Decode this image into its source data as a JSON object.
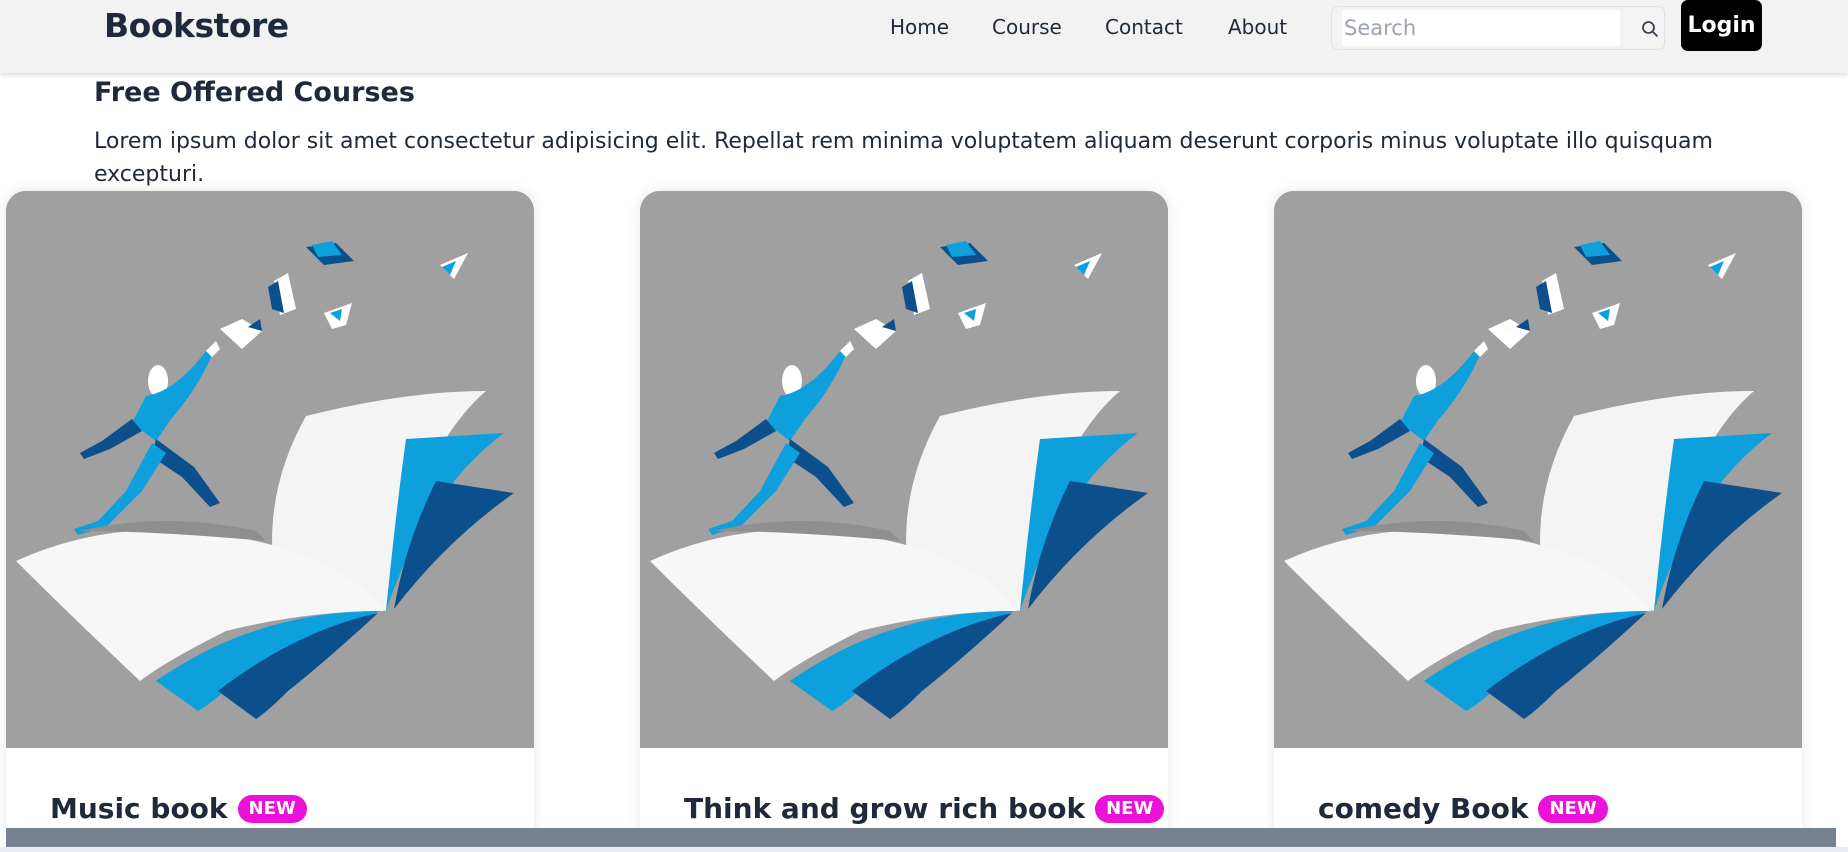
{
  "brand": "Bookstore",
  "nav": {
    "home": "Home",
    "course": "Course",
    "contact": "Contact",
    "about": "About"
  },
  "search": {
    "placeholder": "Search",
    "value": ""
  },
  "login_label": "Login",
  "section": {
    "title": "Free Offered Courses",
    "description": "Lorem ipsum dolor sit amet consectetur adipisicing elit. Repellat rem minima voluptatem aliquam deserunt corporis minus voluptate illo quisquam excepturi."
  },
  "cards": [
    {
      "title": "Music book",
      "badge": "NEW"
    },
    {
      "title": "Think and grow rich book",
      "badge": "NEW"
    },
    {
      "title": "comedy Book",
      "badge": "NEW"
    }
  ],
  "colors": {
    "navbar_bg": "#f2f2f2",
    "login_bg": "#000000",
    "badge_bg": "#ec11d6",
    "illustration_bg": "#a3a3a3",
    "blue_light": "#0ea0dc",
    "blue_dark": "#0b4f8c"
  },
  "icons": {
    "search": "search-icon"
  }
}
